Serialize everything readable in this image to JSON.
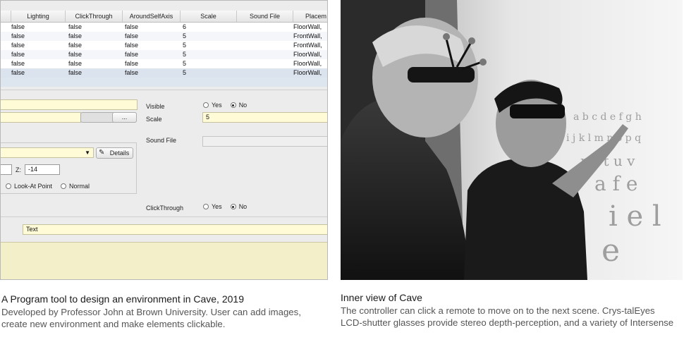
{
  "table": {
    "columns": [
      "Lighting",
      "ClickThrough",
      "AroundSelfAxis",
      "Scale",
      "Sound File",
      "Placem"
    ],
    "rows": [
      {
        "lighting": "false",
        "clickthrough": "false",
        "aroundselfaxis": "false",
        "scale": "6",
        "sound": "",
        "placement": "FloorWall,"
      },
      {
        "lighting": "false",
        "clickthrough": "false",
        "aroundselfaxis": "false",
        "scale": "5",
        "sound": "",
        "placement": "FrontWall,"
      },
      {
        "lighting": "false",
        "clickthrough": "false",
        "aroundselfaxis": "false",
        "scale": "5",
        "sound": "",
        "placement": "FrontWall,"
      },
      {
        "lighting": "false",
        "clickthrough": "false",
        "aroundselfaxis": "false",
        "scale": "5",
        "sound": "",
        "placement": "FloorWall,"
      },
      {
        "lighting": "false",
        "clickthrough": "false",
        "aroundselfaxis": "false",
        "scale": "5",
        "sound": "",
        "placement": "FloorWall,"
      },
      {
        "lighting": "false",
        "clickthrough": "false",
        "aroundselfaxis": "false",
        "scale": "5",
        "sound": "",
        "placement": "FloorWall,"
      }
    ]
  },
  "form": {
    "browse_label": "...",
    "details_label": "Details",
    "z_label": "Z:",
    "z_value": "-14",
    "look_at_label": "Look-At Point",
    "normal_label": "Normal",
    "visible_label": "Visible",
    "scale_label": "Scale",
    "scale_value": "5",
    "sound_file_label": "Sound File",
    "clickthrough_label": "ClickThrough",
    "yes_label": "Yes",
    "no_label": "No",
    "text_value": "Text"
  },
  "captions": {
    "left_title": "A Program tool to design an environment in Cave, 2019",
    "left_body": "Developed by Professor John at Brown University. User can add images, create new environment and make elements clickable.",
    "right_title": "Inner view of Cave",
    "right_body": "The controller can click a remote to move on to the next scene.  Crys-talEyes LCD-shutter glasses provide stereo depth-perception, and a variety of Intersense"
  },
  "colors": {
    "field_bg": "#fffbd6",
    "selected_row": "#dbe3ee",
    "caption_text": "#555555"
  }
}
